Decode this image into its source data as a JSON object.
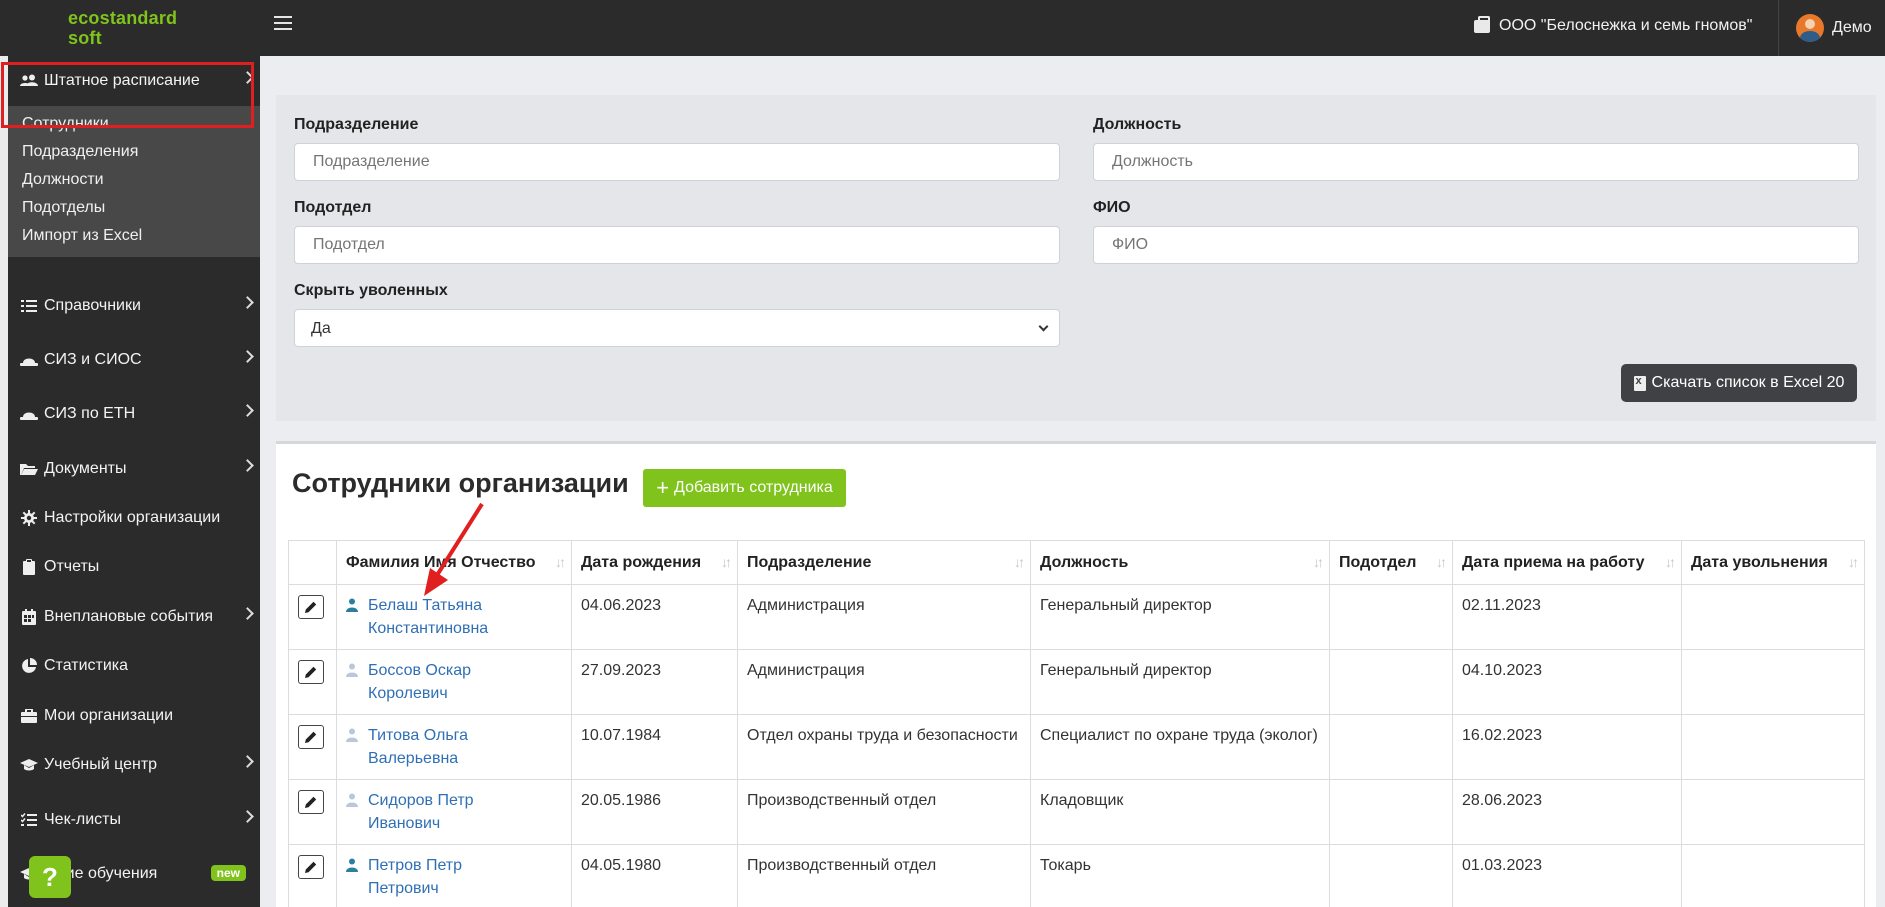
{
  "topbar": {
    "logo_line1": "ecostandard",
    "logo_line2": "soft",
    "org_name": "ООО \"Белоснежка и семь гномов\"",
    "user_name": "Демо"
  },
  "sidebar": {
    "items": [
      {
        "label": "Штатное расписание",
        "icon": "users-icon"
      },
      {
        "label": "Справочники",
        "icon": "list-icon"
      },
      {
        "label": "СИЗ и СИОС",
        "icon": "hard-hat-icon"
      },
      {
        "label": "СИЗ по ЕТН",
        "icon": "hard-hat-icon"
      },
      {
        "label": "Документы",
        "icon": "folder-open-icon"
      },
      {
        "label": "Настройки организации",
        "icon": "gear-icon"
      },
      {
        "label": "Отчеты",
        "icon": "clipboard-icon"
      },
      {
        "label": "Внеплановые события",
        "icon": "calendar-icon"
      },
      {
        "label": "Статистика",
        "icon": "pie-chart-icon"
      },
      {
        "label": "Мои организации",
        "icon": "briefcase-icon"
      },
      {
        "label": "Учебный центр",
        "icon": "graduation-cap-icon"
      },
      {
        "label": "Чек-листы",
        "icon": "checklist-icon"
      },
      {
        "label": "шние обучения",
        "icon": "graduation-cap-icon",
        "badge": "new"
      }
    ],
    "submenu": [
      "Сотрудники",
      "Подразделения",
      "Должности",
      "Подотделы",
      "Импорт из Excel"
    ],
    "help": "?"
  },
  "filters": {
    "department_label": "Подразделение",
    "department_placeholder": "Подразделение",
    "position_label": "Должность",
    "position_placeholder": "Должность",
    "subdept_label": "Подотдел",
    "subdept_placeholder": "Подотдел",
    "fio_label": "ФИО",
    "fio_placeholder": "ФИО",
    "hide_fired_label": "Скрыть уволенных",
    "hide_fired_value": "Да",
    "excel_button": "Скачать список в Excel 20"
  },
  "main": {
    "title": "Сотрудники организации",
    "add_button": "Добавить сотрудника"
  },
  "table": {
    "columns": [
      "Фамилия Имя Отчество",
      "Дата рождения",
      "Подразделение",
      "Должность",
      "Подотдел",
      "Дата приема на работу",
      "Дата увольнения"
    ],
    "rows": [
      {
        "name1": "Белаш Татьяна",
        "name2": "Константиновна",
        "birth": "04.06.2023",
        "dept": "Администрация",
        "position": "Генеральный директор",
        "subdept": "",
        "hired": "02.11.2023",
        "fired": "",
        "icon_active": true
      },
      {
        "name1": "Боссов Оскар",
        "name2": "Королевич",
        "birth": "27.09.2023",
        "dept": "Администрация",
        "position": "Генеральный директор",
        "subdept": "",
        "hired": "04.10.2023",
        "fired": "",
        "icon_active": false
      },
      {
        "name1": "Титова Ольга",
        "name2": "Валерьевна",
        "birth": "10.07.1984",
        "dept": "Отдел охраны труда и безопасности",
        "position": "Специалист по охране труда (эколог)",
        "subdept": "",
        "hired": "16.02.2023",
        "fired": "",
        "icon_active": false
      },
      {
        "name1": "Сидоров Петр",
        "name2": "Иванович",
        "birth": "20.05.1986",
        "dept": "Производственный отдел",
        "position": "Кладовщик",
        "subdept": "",
        "hired": "28.06.2023",
        "fired": "",
        "icon_active": false
      },
      {
        "name1": "Петров Петр",
        "name2": "Петрович",
        "birth": "04.05.1980",
        "dept": "Производственный отдел",
        "position": "Токарь",
        "subdept": "",
        "hired": "01.03.2023",
        "fired": "",
        "icon_active": true
      }
    ]
  },
  "colors": {
    "accent_green": "#7fc31c",
    "dark_bg": "#2b2b2b",
    "link_blue": "#2f6fb5",
    "highlight_red": "#e02020",
    "person_active": "#2a7fa0",
    "person_inactive": "#b8c7d9"
  }
}
